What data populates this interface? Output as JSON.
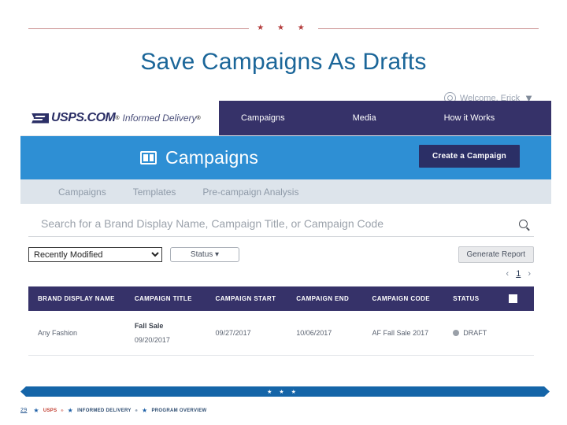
{
  "slide": {
    "divider_stars": "★ ★ ★",
    "title": "Save Campaigns As Drafts"
  },
  "app": {
    "welcome": {
      "text": "Welcome, Erick",
      "user_icon": "user-circle-icon",
      "chevron": "▼"
    },
    "brand": {
      "eagle_icon": "usps-eagle-icon",
      "name": "USPS.COM",
      "registered": "®",
      "product": "Informed Delivery",
      "product_registered": "®"
    },
    "topnav": [
      {
        "label": "Campaigns"
      },
      {
        "label": "Media"
      },
      {
        "label": "How it Works"
      }
    ],
    "banner": {
      "icon": "campaigns-grid-icon",
      "title": "Campaigns",
      "create_button": "Create a Campaign"
    },
    "subtabs": [
      {
        "label": "Campaigns"
      },
      {
        "label": "Templates"
      },
      {
        "label": "Pre-campaign Analysis"
      }
    ],
    "search": {
      "placeholder": "Search for a Brand Display Name, Campaign Title, or Campaign Code",
      "value": "",
      "icon": "search-icon"
    },
    "filters": {
      "sort_value": "Recently Modified",
      "sort_options": [
        "Recently Modified"
      ],
      "status_label": "Status ▾",
      "generate_report": "Generate Report"
    },
    "pagination": {
      "prev": "‹",
      "page": "1",
      "next": "›"
    },
    "table": {
      "columns": [
        "BRAND DISPLAY NAME",
        "CAMPAIGN TITLE",
        "CAMPAIGN START",
        "CAMPAIGN END",
        "CAMPAIGN CODE",
        "STATUS",
        ""
      ],
      "rows": [
        {
          "brand_display_name": "Any Fashion",
          "campaign_title": "Fall Sale",
          "campaign_title_date": "09/20/2017",
          "campaign_start": "09/27/2017",
          "campaign_end": "10/06/2017",
          "campaign_code": "AF Fall Sale 2017",
          "status": "DRAFT"
        }
      ]
    }
  },
  "footer": {
    "band_stars": "★★★",
    "page_number": "29",
    "star": "★",
    "usps": "USPS",
    "usps_sup": "®",
    "informed_delivery": "INFORMED DELIVERY",
    "informed_delivery_sup": "®",
    "program_overview": "PROGRAM OVERVIEW"
  },
  "colors": {
    "navy": "#363269",
    "banner_blue": "#2e8fd4",
    "title_blue": "#1b6699",
    "subtab_bg": "#dde4eb",
    "footer_blue": "#1565a8",
    "divider_red": "#c98e8e",
    "status_dot": "#9aa0a8"
  }
}
